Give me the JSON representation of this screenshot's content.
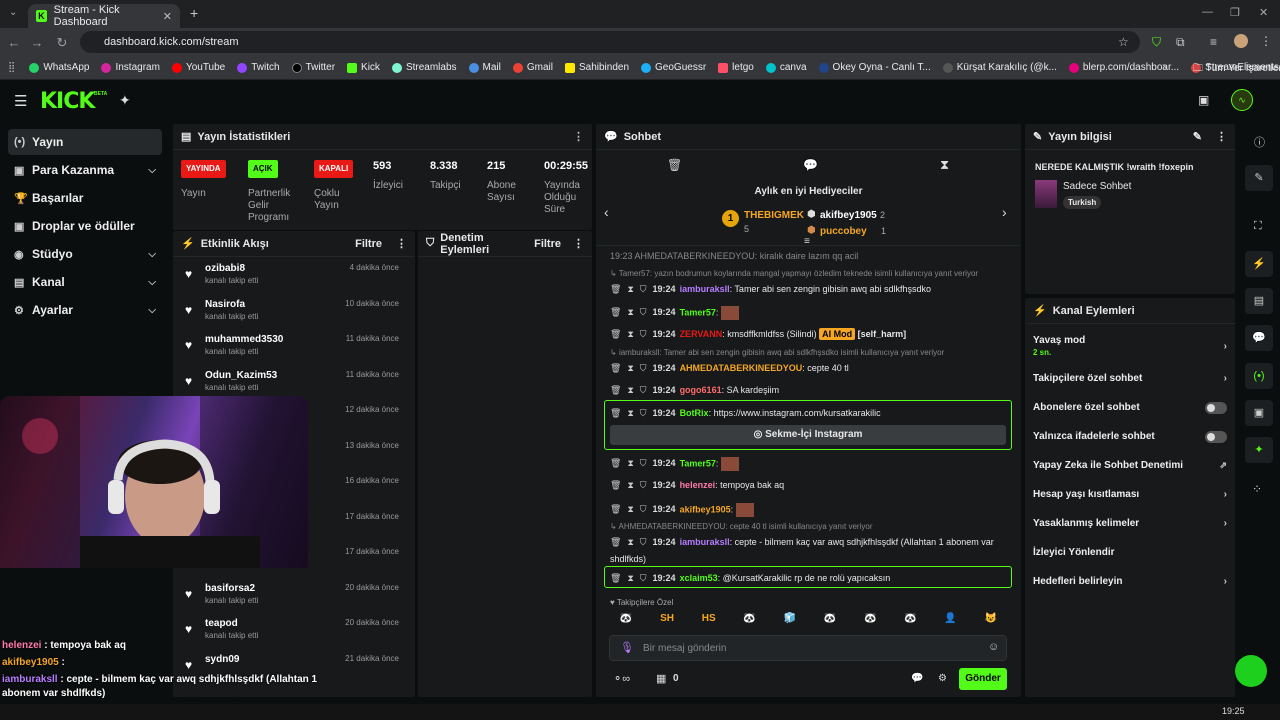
{
  "browser": {
    "tab_title": "Stream - Kick Dashboard",
    "url": "dashboard.kick.com/stream",
    "bookmarks": [
      "WhatsApp",
      "Instagram",
      "YouTube",
      "Twitch",
      "Twitter",
      "Kick",
      "Streamlabs",
      "Mail",
      "Gmail",
      "Sahibinden",
      "GeoGuessr",
      "letgo",
      "canva",
      "Okey Oyna - Canlı T...",
      "Kürşat Karakılıç (@k...",
      "blerp.com/dashboar...",
      "StreamElements"
    ],
    "all_bookmarks": "Tüm Yer İşaretleri"
  },
  "brand": {
    "logo": "KICK",
    "beta": "BETA"
  },
  "sidebar": {
    "items": [
      {
        "label": "Yayın",
        "icon": "(•)"
      },
      {
        "label": "Para Kazanma",
        "icon": "▣"
      },
      {
        "label": "Başarılar",
        "icon": "🏆"
      },
      {
        "label": "Droplar ve ödüller",
        "icon": "▣"
      },
      {
        "label": "Stüdyo",
        "icon": "◉"
      },
      {
        "label": "Kanal",
        "icon": "▤"
      },
      {
        "label": "Ayarlar",
        "icon": "⚙"
      }
    ]
  },
  "stats": {
    "title": "Yayın İstatistikleri",
    "badges": [
      {
        "badge": "YAYINDA",
        "label1": "Yayın",
        "label2": "",
        "label3": "",
        "color": "#e91916"
      },
      {
        "badge": "AÇIK",
        "label1": "Partnerlik",
        "label2": "Gelir",
        "label3": "Programı",
        "color": "#53fc18"
      },
      {
        "badge": "KAPALI",
        "label1": "Çoklu",
        "label2": "Yayın",
        "label3": "",
        "color": "#e91916"
      }
    ],
    "nums": [
      {
        "value": "593",
        "label1": "İzleyici",
        "label2": "",
        "label3": ""
      },
      {
        "value": "8.338",
        "label1": "Takipçi",
        "label2": "",
        "label3": ""
      },
      {
        "value": "215",
        "label1": "Abone",
        "label2": "Sayısı",
        "label3": ""
      },
      {
        "value": "00:29:55",
        "label1": "Yayında",
        "label2": "Olduğu",
        "label3": "Süre"
      }
    ]
  },
  "activity": {
    "title": "Etkinlik Akışı",
    "filter": "Filtre",
    "items": [
      {
        "name": "ozibabi8",
        "sub": "kanalı takip etti",
        "time": "4 dakika önce"
      },
      {
        "name": "Nasirofa",
        "sub": "kanalı takip etti",
        "time": "10 dakika önce"
      },
      {
        "name": "muhammed3530",
        "sub": "kanalı takip etti",
        "time": "11 dakika önce"
      },
      {
        "name": "Odun_Kazim53",
        "sub": "kanalı takip etti",
        "time": "11 dakika önce"
      },
      {
        "name": "",
        "sub": "",
        "time": "12 dakika önce"
      },
      {
        "name": "",
        "sub": "",
        "time": "13 dakika önce"
      },
      {
        "name": "",
        "sub": "",
        "time": "16 dakika önce"
      },
      {
        "name": "",
        "sub": "",
        "time": "17 dakika önce"
      },
      {
        "name": "",
        "sub": "kanalı takip etti",
        "time": "17 dakika önce"
      },
      {
        "name": "basiforsa2",
        "sub": "kanalı takip etti",
        "time": "20 dakika önce"
      },
      {
        "name": "teapod",
        "sub": "kanalı takip etti",
        "time": "20 dakika önce"
      },
      {
        "name": "sydn09",
        "sub": "",
        "time": "21 dakika önce"
      }
    ]
  },
  "moderation": {
    "title": "Denetim Eylemleri",
    "filter": "Filtre"
  },
  "chat": {
    "title": "Sohbet",
    "gifters_title": "Aylık en iyi Hediyeciler",
    "gifters": [
      {
        "rank": "1",
        "name": "THEBIGMEK",
        "count": "5"
      },
      {
        "name": "akifbey1905",
        "count": "2"
      },
      {
        "name": "puccobey",
        "count": "1"
      }
    ],
    "top_partial": "19:23  AHMEDATABERKINEEDYOU: kiralık daire lazım qq acil",
    "messages": [
      {
        "kind": "reply",
        "text": "Tamer57: yazın bodrumun koylarında mangal yapmayı özledim teknede isimli kullanıcıya yanıt veriyor"
      },
      {
        "kind": "msg",
        "time": "19:24",
        "user": "iamburaksll",
        "color": "#b77dff",
        "text": ": Tamer abi sen zengin gibisin awq abi sdlkfhşsdko"
      },
      {
        "kind": "msg",
        "time": "19:24",
        "user": "Tamer57",
        "color": "#53fc18",
        "text": ":"
      },
      {
        "kind": "msg",
        "time": "19:24",
        "user": "ZERVANN",
        "color": "#e91916",
        "text": ": kmsdffkmldfss (Silindi)",
        "tag": "AI Mod",
        "extra": "[self_harm]"
      },
      {
        "kind": "reply",
        "text": "iamburaksll: Tamer abi sen zengin gibisin awq abi sdlkfhşsdko isimli kullanıcıya yanıt veriyor"
      },
      {
        "kind": "msg",
        "time": "19:24",
        "user": "AHMEDATABERKINEEDYOU",
        "color": "#f5a623",
        "text": ": cepte 40 tl"
      },
      {
        "kind": "msg",
        "time": "19:24",
        "user": "gogo6161",
        "color": "#ff6b6b",
        "text": ": SA kardeşiim"
      },
      {
        "kind": "msg",
        "time": "19:24",
        "user": "BotRix",
        "color": "#53fc18",
        "text": ": https://www.instagram.com/kursatkarakilic"
      },
      {
        "kind": "msg",
        "time": "19:24",
        "user": "Tamer57",
        "color": "#53fc18",
        "text": ":"
      },
      {
        "kind": "msg",
        "time": "19:24",
        "user": "helenzei",
        "color": "#ff7aa8",
        "text": ": tempoya bak aq"
      },
      {
        "kind": "msg",
        "time": "19:24",
        "user": "akifbey1905",
        "color": "#f5a623",
        "text": ":"
      },
      {
        "kind": "reply",
        "text": "AHMEDATABERKINEEDYOU: cepte 40 tl isimli kullanıcıya yanıt veriyor"
      },
      {
        "kind": "msg",
        "time": "19:24",
        "user": "iamburaksll",
        "color": "#b77dff",
        "text": ": cepte - bilmem kaç var awq sdhjkfhlsşdkf (Allahtan 1 abonem var"
      },
      {
        "kind": "cont",
        "text": "shdlfkds)"
      },
      {
        "kind": "msg",
        "time": "19:24",
        "user": "xclaim53",
        "color": "#53fc18",
        "text": ": @KursatKarakilic rp de ne rolü yapıcaksın"
      }
    ],
    "bot_button": "Sekme-İçi Instagram",
    "followers_only": "Takipçilere Özel",
    "emotes": [
      "🐼",
      "SH",
      "HS",
      "🐼",
      "🧊",
      "🐼",
      "🐼",
      "🐼",
      "👤",
      "😺"
    ],
    "input_placeholder": "Bir mesaj gönderin",
    "points": "0",
    "send": "Gönder"
  },
  "stream_info": {
    "title": "Yayın bilgisi",
    "stream_title": "NEREDE KALMIŞTIK !wraith !foxepin",
    "category": "Sadece Sohbet",
    "language": "Turkish"
  },
  "channel_actions": {
    "title": "Kanal Eylemleri",
    "items": [
      {
        "label": "Yavaş mod",
        "sub": "2 sn.",
        "control": "chevron"
      },
      {
        "label": "Takipçilere özel sohbet",
        "sub": "",
        "control": "chevron"
      },
      {
        "label": "Abonelere özel sohbet",
        "sub": "",
        "control": "toggle"
      },
      {
        "label": "Yalnızca ifadelerle sohbet",
        "sub": "",
        "control": "toggle"
      },
      {
        "label": "Yapay Zeka ile Sohbet Denetimi",
        "sub": "",
        "control": "external"
      },
      {
        "label": "Hesap yaşı kısıtlaması",
        "sub": "",
        "control": "chevron"
      },
      {
        "label": "Yasaklanmış kelimeler",
        "sub": "",
        "control": "chevron"
      },
      {
        "label": "İzleyici Yönlendir",
        "sub": "",
        "control": "none"
      },
      {
        "label": "Hedefleri belirleyin",
        "sub": "",
        "control": "chevron"
      }
    ]
  },
  "overlay": {
    "lines": [
      {
        "user": "helenzei",
        "text": " : tempoya bak aq",
        "color": "#ff7aa8"
      },
      {
        "user": "akifbey1905",
        "text": " :",
        "color": "#f5a623"
      },
      {
        "user": "iamburaksll",
        "text": " : cepte - bilmem kaç var awq sdhjkfhlsşdkf (Allahtan 1",
        "color": "#b77dff"
      },
      {
        "user": "",
        "text": "abonem var shdlfkds)",
        "color": "#fff"
      },
      {
        "user": "xclaim53",
        "text": " : @KursatKarakilic rp de ne rolü yapıcaksın",
        "color": "#53fc18"
      }
    ]
  },
  "taskbar": {
    "time": "19:25"
  },
  "colors": {
    "accent": "#53fc18",
    "panel": "#17191b",
    "bg": "#0b0e0f",
    "live": "#e91916"
  }
}
